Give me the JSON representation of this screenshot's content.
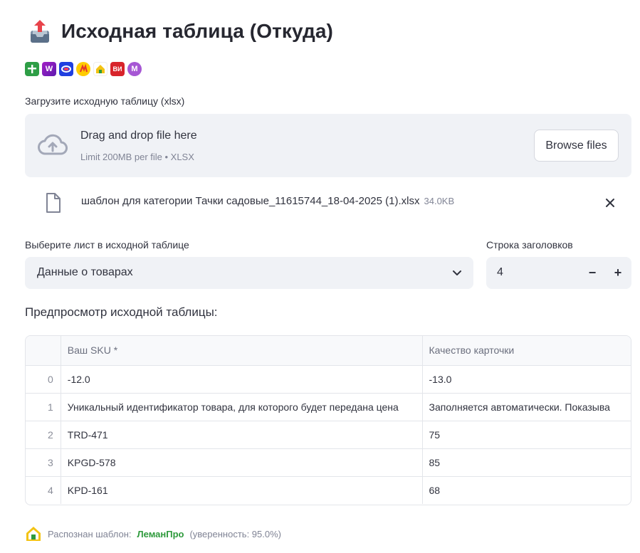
{
  "header": {
    "title": "Исходная таблица (Откуда)",
    "title_icon": "inbox-tray-icon"
  },
  "marketplaces": [
    {
      "name": "plus-badge",
      "glyph": "",
      "color": "#2e9e46"
    },
    {
      "name": "wildberries-badge",
      "glyph": "W",
      "color": "#8a1bb8"
    },
    {
      "name": "ozon-badge",
      "glyph": "",
      "color": "#1f3fe0"
    },
    {
      "name": "yandex-market-badge",
      "glyph": "",
      "color": "#ffcc00"
    },
    {
      "name": "lemanpro-badge",
      "glyph": "",
      "color": "#f3c313"
    },
    {
      "name": "vseinstrumenti-badge",
      "glyph": "ВИ",
      "color": "#d8242b"
    },
    {
      "name": "megamarket-badge",
      "glyph": "М",
      "color": "#a657d4"
    }
  ],
  "uploader": {
    "label": "Загрузите исходную таблицу (xlsx)",
    "drop_title": "Drag and drop file here",
    "drop_subtitle": "Limit 200MB per file • XLSX",
    "browse_label": "Browse files"
  },
  "uploaded_file": {
    "name": "шаблон для категории Тачки садовые_11615744_18-04-2025 (1).xlsx",
    "size": "34.0KB"
  },
  "sheet_select": {
    "label": "Выберите лист в исходной таблице",
    "value": "Данные о товарах"
  },
  "header_row": {
    "label": "Строка заголовков",
    "value": "4",
    "minus": "−",
    "plus": "+"
  },
  "preview": {
    "title": "Предпросмотр исходной таблицы:",
    "columns": [
      "",
      "Ваш SKU *",
      "Качество карточки"
    ],
    "rows": [
      [
        "0",
        "-12.0",
        "-13.0"
      ],
      [
        "1",
        "Уникальный идентификатор товара, для которого будет передана цена",
        "Заполняется автоматически. Показыва"
      ],
      [
        "2",
        "TRD-471",
        "75"
      ],
      [
        "3",
        "KPGD-578",
        "85"
      ],
      [
        "4",
        "KPD-161",
        "68"
      ]
    ]
  },
  "footer": {
    "prefix": "Распознан шаблон:",
    "brand": "ЛеманПро",
    "suffix": "(уверенность: 95.0%)"
  },
  "colors": {
    "surface": "#f0f2f6",
    "accent_green": "#2e9a3c",
    "text": "#31333f",
    "muted": "#808495"
  }
}
